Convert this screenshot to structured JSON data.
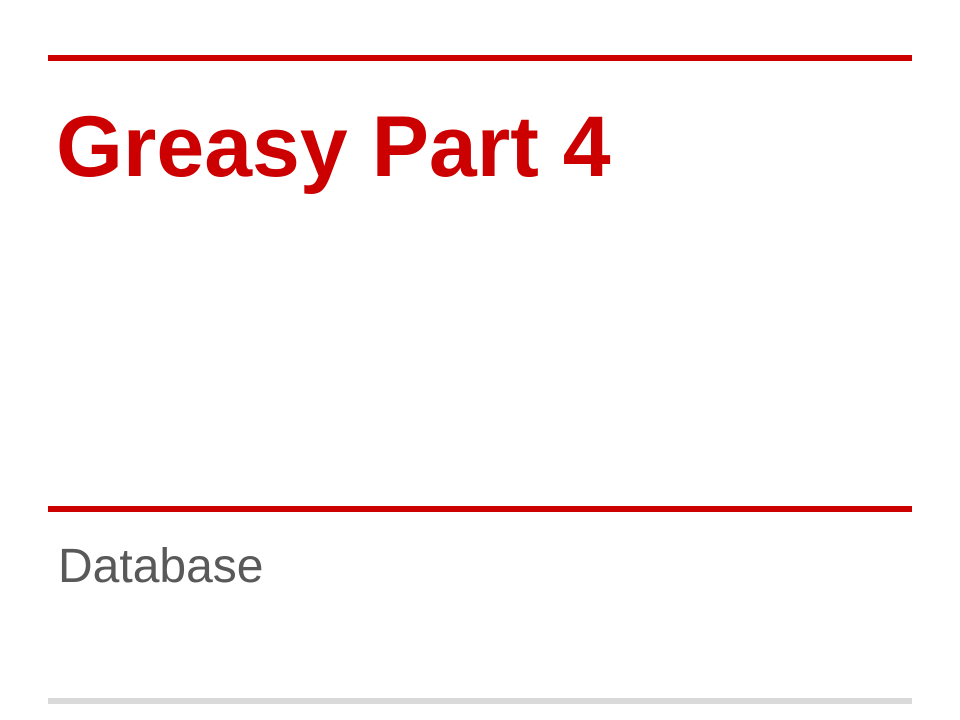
{
  "slide": {
    "title": "Greasy Part 4",
    "subtitle": "Database"
  },
  "colors": {
    "accent": "#cc0000",
    "subtitle_text": "#595959",
    "footer_rule": "#d9d9d9",
    "background": "#ffffff"
  }
}
